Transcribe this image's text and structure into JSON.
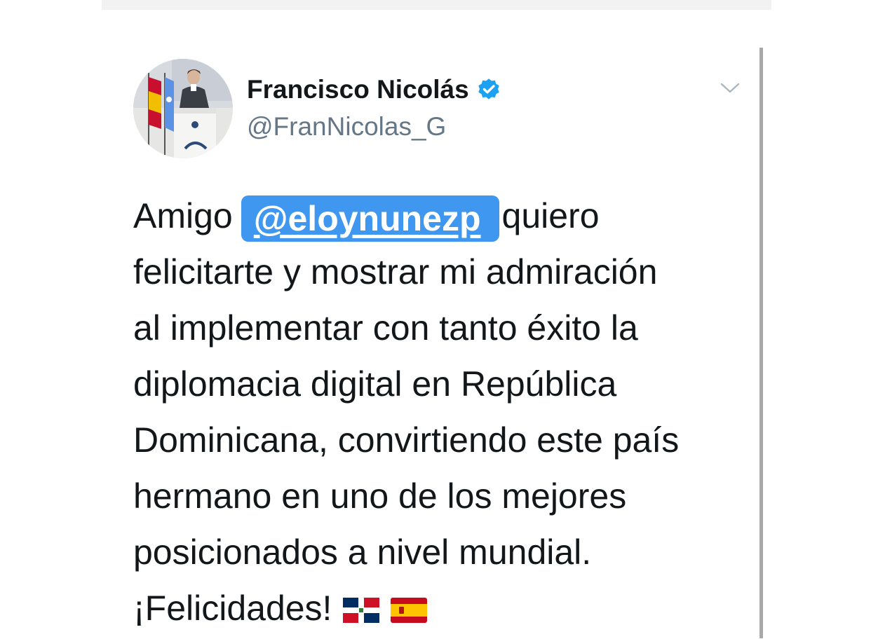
{
  "tweet": {
    "author": {
      "display_name": "Francisco Nicolás",
      "handle": "@FranNicolas_G",
      "verified": true,
      "avatar_icon": "profile-photo-icon"
    },
    "menu_icon": "chevron-down-icon",
    "text": {
      "line1_before": "Amigo",
      "mention": "@eloynunezp",
      "line1_after": "quiero",
      "line2": "felicitarte y mostrar mi admiración",
      "line3": "al implementar con tanto éxito la",
      "line4": "diplomacia digital en República",
      "line5": "Dominicana, convirtiendo este país",
      "line6": "hermano en uno de los mejores",
      "line7": "posicionados a nivel mundial.",
      "line8": "¡Felicidades!"
    },
    "emoji": [
      "dominican-republic-flag-icon",
      "spain-flag-icon"
    ]
  },
  "colors": {
    "mention_highlight": "#3f97ef",
    "verified_badge": "#1da1f2",
    "handle_text": "#657786",
    "card_border": "#a9a9a9"
  }
}
